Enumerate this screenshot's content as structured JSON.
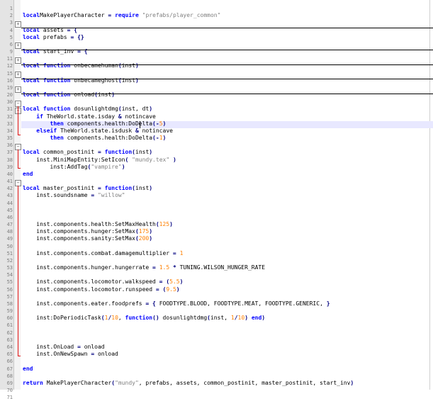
{
  "lines": [
    {
      "n": "1",
      "parts": []
    },
    {
      "n": "2",
      "parts": [
        [
          "kw",
          "local"
        ],
        [
          "",
          "MakePlayerCharacter "
        ],
        [
          "op",
          "="
        ],
        [
          "",
          " "
        ],
        [
          "kw",
          "require"
        ],
        [
          "",
          " "
        ],
        [
          "str",
          "\"prefabs/player_common\""
        ]
      ]
    },
    {
      "n": "3",
      "parts": []
    },
    {
      "n": "4",
      "parts": [
        [
          "kw",
          "local"
        ],
        [
          "",
          " assets "
        ],
        [
          "op",
          "="
        ],
        [
          "",
          " "
        ],
        [
          "op",
          "{"
        ]
      ]
    },
    {
      "n": "5",
      "parts": [
        [
          "kw",
          "local"
        ],
        [
          "",
          " prefabs "
        ],
        [
          "op",
          "="
        ],
        [
          "",
          " "
        ],
        [
          "op",
          "{}"
        ]
      ]
    },
    {
      "n": "6",
      "parts": []
    },
    {
      "n": "9",
      "parts": [
        [
          "kw",
          "local"
        ],
        [
          "",
          " start_inv "
        ],
        [
          "op",
          "="
        ],
        [
          "",
          " "
        ],
        [
          "op",
          "{"
        ]
      ]
    },
    {
      "n": "11",
      "parts": []
    },
    {
      "n": "12",
      "parts": [
        [
          "kw",
          "local"
        ],
        [
          "",
          " "
        ],
        [
          "kw",
          "function"
        ],
        [
          "",
          " onbecamehuman"
        ],
        [
          "op",
          "("
        ],
        [
          "",
          "inst"
        ],
        [
          "op",
          ")"
        ]
      ]
    },
    {
      "n": "15",
      "parts": []
    },
    {
      "n": "16",
      "parts": [
        [
          "kw",
          "local"
        ],
        [
          "",
          " "
        ],
        [
          "kw",
          "function"
        ],
        [
          "",
          " onbecameghost"
        ],
        [
          "op",
          "("
        ],
        [
          "",
          "inst"
        ],
        [
          "op",
          ")"
        ]
      ]
    },
    {
      "n": "19",
      "parts": []
    },
    {
      "n": "20",
      "parts": [
        [
          "kw",
          "local"
        ],
        [
          "",
          " "
        ],
        [
          "kw",
          "function"
        ],
        [
          "",
          " onload"
        ],
        [
          "op",
          "("
        ],
        [
          "",
          "inst"
        ],
        [
          "op",
          ")"
        ]
      ]
    },
    {
      "n": "30",
      "parts": []
    },
    {
      "n": "31",
      "parts": [
        [
          "kw",
          "local"
        ],
        [
          "",
          " "
        ],
        [
          "kw",
          "function"
        ],
        [
          "",
          " dosunlightdmg"
        ],
        [
          "op",
          "("
        ],
        [
          "",
          "inst, dt"
        ],
        [
          "op",
          ")"
        ]
      ]
    },
    {
      "n": "32",
      "parts": [
        [
          "",
          "    "
        ],
        [
          "kw",
          "if"
        ],
        [
          "",
          " TheWorld.state.isday "
        ],
        [
          "op",
          "&"
        ],
        [
          "",
          " notincave"
        ]
      ]
    },
    {
      "n": "33",
      "parts": [
        [
          "",
          "        "
        ],
        [
          "kw",
          "then"
        ],
        [
          "",
          " components.health:DoDelta"
        ],
        [
          "op",
          "("
        ],
        [
          "op",
          "-"
        ],
        [
          "num",
          "5"
        ],
        [
          "op",
          ")"
        ]
      ]
    },
    {
      "n": "34",
      "parts": [
        [
          "",
          "    "
        ],
        [
          "kw",
          "elseif"
        ],
        [
          "",
          " TheWorld.state.isdusk "
        ],
        [
          "op",
          "&"
        ],
        [
          "",
          " notincave"
        ]
      ]
    },
    {
      "n": "35",
      "parts": [
        [
          "",
          "        "
        ],
        [
          "kw",
          "then"
        ],
        [
          "",
          " components.health:DoDelta"
        ],
        [
          "op",
          "("
        ],
        [
          "op",
          "-"
        ],
        [
          "num",
          "1"
        ],
        [
          "op",
          ")"
        ]
      ]
    },
    {
      "n": "36",
      "parts": []
    },
    {
      "n": "37",
      "parts": [
        [
          "kw",
          "local"
        ],
        [
          "",
          " common_postinit "
        ],
        [
          "op",
          "="
        ],
        [
          "",
          " "
        ],
        [
          "kw",
          "function"
        ],
        [
          "op",
          "("
        ],
        [
          "",
          "inst"
        ],
        [
          "op",
          ")"
        ]
      ]
    },
    {
      "n": "38",
      "parts": [
        [
          "",
          "    inst.MiniMapEntity:SetIcon"
        ],
        [
          "op",
          "("
        ],
        [
          "",
          " "
        ],
        [
          "str",
          "\"mundy.tex\""
        ],
        [
          "",
          " "
        ],
        [
          "op",
          ")"
        ]
      ]
    },
    {
      "n": "39",
      "parts": [
        [
          "",
          "        inst:AddTag"
        ],
        [
          "op",
          "("
        ],
        [
          "str",
          "\"vampire\""
        ],
        [
          "op",
          ")"
        ]
      ]
    },
    {
      "n": "40",
      "parts": [
        [
          "kw",
          "end"
        ]
      ]
    },
    {
      "n": "41",
      "parts": []
    },
    {
      "n": "42",
      "parts": [
        [
          "kw",
          "local"
        ],
        [
          "",
          " master_postinit "
        ],
        [
          "op",
          "="
        ],
        [
          "",
          " "
        ],
        [
          "kw",
          "function"
        ],
        [
          "op",
          "("
        ],
        [
          "",
          "inst"
        ],
        [
          "op",
          ")"
        ]
      ]
    },
    {
      "n": "43",
      "parts": [
        [
          "",
          "    inst.soundsname "
        ],
        [
          "op",
          "="
        ],
        [
          "",
          " "
        ],
        [
          "str",
          "\"willow\""
        ]
      ]
    },
    {
      "n": "44",
      "parts": []
    },
    {
      "n": "45",
      "parts": []
    },
    {
      "n": "46",
      "parts": []
    },
    {
      "n": "47",
      "parts": [
        [
          "",
          "    inst.components.health:SetMaxHealth"
        ],
        [
          "op",
          "("
        ],
        [
          "num",
          "125"
        ],
        [
          "op",
          ")"
        ]
      ]
    },
    {
      "n": "48",
      "parts": [
        [
          "",
          "    inst.components.hunger:SetMax"
        ],
        [
          "op",
          "("
        ],
        [
          "num",
          "175"
        ],
        [
          "op",
          ")"
        ]
      ]
    },
    {
      "n": "49",
      "parts": [
        [
          "",
          "    inst.components.sanity:SetMax"
        ],
        [
          "op",
          "("
        ],
        [
          "num",
          "200"
        ],
        [
          "op",
          ")"
        ]
      ]
    },
    {
      "n": "50",
      "parts": []
    },
    {
      "n": "51",
      "parts": [
        [
          "",
          "    inst.components.combat.damagemultiplier "
        ],
        [
          "op",
          "="
        ],
        [
          "",
          " "
        ],
        [
          "num",
          "1"
        ]
      ]
    },
    {
      "n": "52",
      "parts": []
    },
    {
      "n": "53",
      "parts": [
        [
          "",
          "    inst.components.hunger.hungerrate "
        ],
        [
          "op",
          "="
        ],
        [
          "",
          " "
        ],
        [
          "num",
          "1.5"
        ],
        [
          "",
          " "
        ],
        [
          "op",
          "*"
        ],
        [
          "",
          " TUNING.WILSON_HUNGER_RATE"
        ]
      ]
    },
    {
      "n": "54",
      "parts": []
    },
    {
      "n": "55",
      "parts": [
        [
          "",
          "    inst.components.locomotor.walkspeed "
        ],
        [
          "op",
          "="
        ],
        [
          "",
          " "
        ],
        [
          "op",
          "("
        ],
        [
          "num",
          "5.5"
        ],
        [
          "op",
          ")"
        ]
      ]
    },
    {
      "n": "56",
      "parts": [
        [
          "",
          "    inst.components.locomotor.runspeed "
        ],
        [
          "op",
          "="
        ],
        [
          "",
          " "
        ],
        [
          "op",
          "("
        ],
        [
          "num",
          "9.5"
        ],
        [
          "op",
          ")"
        ]
      ]
    },
    {
      "n": "57",
      "parts": []
    },
    {
      "n": "58",
      "parts": [
        [
          "",
          "    inst.components.eater.foodprefs "
        ],
        [
          "op",
          "="
        ],
        [
          "",
          " "
        ],
        [
          "op",
          "{"
        ],
        [
          "",
          " FOODTYPE.BLOOD, FOODTYPE.MEAT, FOODTYPE.GENERIC, "
        ],
        [
          "op",
          "}"
        ]
      ]
    },
    {
      "n": "59",
      "parts": []
    },
    {
      "n": "60",
      "parts": [
        [
          "",
          "    inst:DoPeriodicTask"
        ],
        [
          "op",
          "("
        ],
        [
          "num",
          "1"
        ],
        [
          "op",
          "/"
        ],
        [
          "num",
          "10"
        ],
        [
          "",
          ", "
        ],
        [
          "kw",
          "function"
        ],
        [
          "op",
          "()"
        ],
        [
          "",
          " dosunlightdmg"
        ],
        [
          "op",
          "("
        ],
        [
          "",
          "inst, "
        ],
        [
          "num",
          "1"
        ],
        [
          "op",
          "/"
        ],
        [
          "num",
          "10"
        ],
        [
          "op",
          ")"
        ],
        [
          "",
          " "
        ],
        [
          "kw",
          "end"
        ],
        [
          "op",
          ")"
        ]
      ]
    },
    {
      "n": "61",
      "parts": []
    },
    {
      "n": "62",
      "parts": []
    },
    {
      "n": "63",
      "parts": []
    },
    {
      "n": "64",
      "parts": [
        [
          "",
          "    inst.OnLoad "
        ],
        [
          "op",
          "="
        ],
        [
          "",
          " onload"
        ]
      ]
    },
    {
      "n": "65",
      "parts": [
        [
          "",
          "    inst.OnNewSpawn "
        ],
        [
          "op",
          "="
        ],
        [
          "",
          " onload"
        ]
      ]
    },
    {
      "n": "66",
      "parts": []
    },
    {
      "n": "67",
      "parts": [
        [
          "kw",
          "end"
        ]
      ]
    },
    {
      "n": "68",
      "parts": []
    },
    {
      "n": "69",
      "parts": [
        [
          "kw",
          "return"
        ],
        [
          "",
          " MakePlayerCharacter"
        ],
        [
          "op",
          "("
        ],
        [
          "str",
          "\"mundy\""
        ],
        [
          "",
          ", prefabs, assets, common_postinit, master_postinit, start_inv"
        ],
        [
          "op",
          ")"
        ]
      ]
    },
    {
      "n": "70",
      "parts": []
    },
    {
      "n": "71",
      "parts": []
    }
  ]
}
